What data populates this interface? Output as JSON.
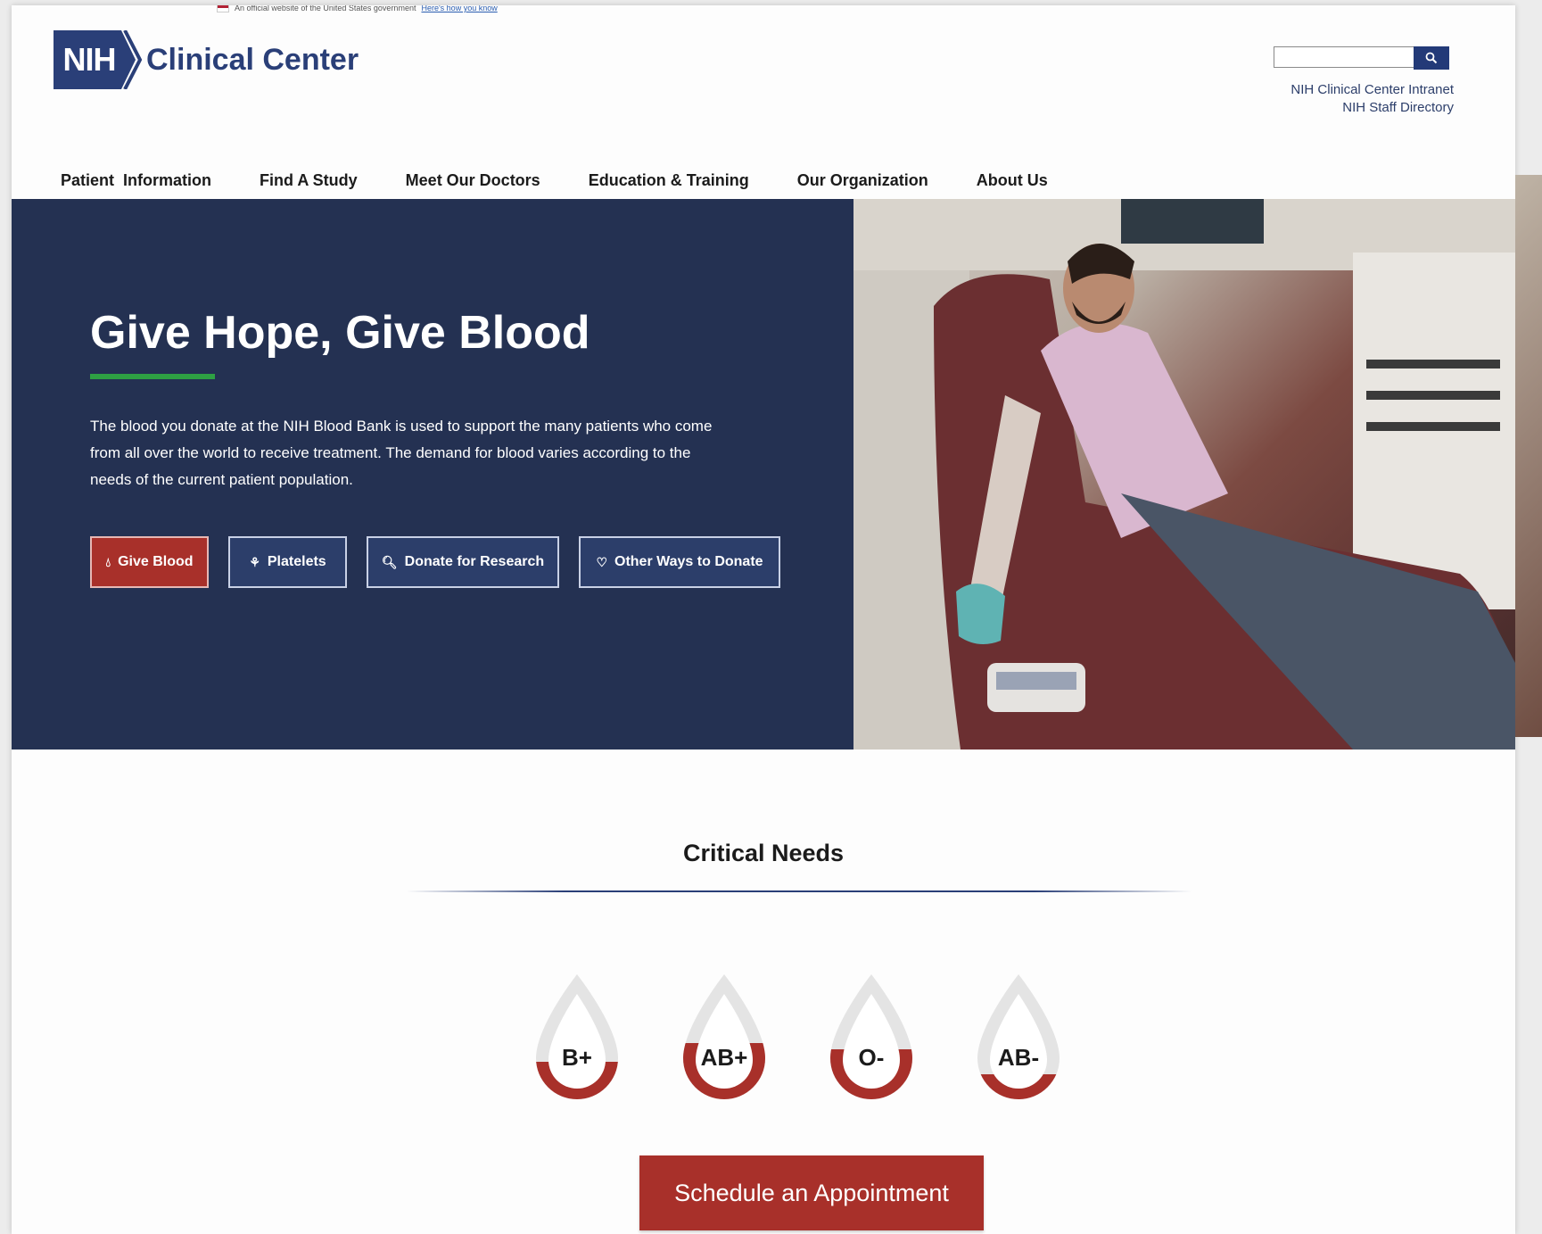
{
  "gov_banner": {
    "text": "An official website of the United States government",
    "link": "Here's how you know"
  },
  "logo": {
    "badge": "NIH",
    "title": "Clinical Center"
  },
  "search": {
    "placeholder": "",
    "button_icon": "search-icon"
  },
  "quick_links": [
    "NIH Clinical Center Intranet",
    "NIH Staff Directory"
  ],
  "nav": [
    "Patient  Information",
    "Find A Study",
    "Meet Our Doctors",
    "Education & Training",
    "Our Organization",
    "About Us"
  ],
  "hero": {
    "title": "Give Hope, Give Blood",
    "text": "The blood you donate at the NIH Blood Bank is used to support the many patients who come from all over the world to receive treatment. The demand for blood varies according to the needs of the current patient population.",
    "buttons": [
      {
        "label": "Give Blood",
        "icon": "drop-icon"
      },
      {
        "label": "Platelets",
        "icon": "platelets-icon"
      },
      {
        "label": "Donate for Research",
        "icon": "research-icon"
      },
      {
        "label": "Other Ways to Donate",
        "icon": "hand-heart-icon"
      }
    ]
  },
  "critical": {
    "title": "Critical Needs",
    "drops": [
      {
        "type": "B+",
        "level": 0.3
      },
      {
        "type": "AB+",
        "level": 0.45
      },
      {
        "type": "O-",
        "level": 0.4
      },
      {
        "type": "AB-",
        "level": 0.2
      }
    ]
  },
  "schedule_label": "Schedule an Appointment",
  "colors": {
    "navy": "#243152",
    "brand_blue": "#2a3f78",
    "red": "#a8302a",
    "green": "#2ea043"
  }
}
